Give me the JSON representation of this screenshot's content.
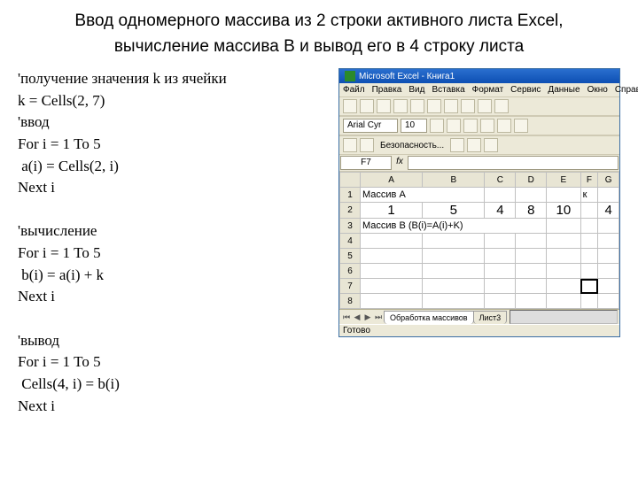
{
  "title_line1": "Ввод одномерного массива из 2 строки активного листа Excel,",
  "title_line2": "вычисление массива B и вывод его в 4 строку листа",
  "code_lines": [
    "'получение значения k из ячейки",
    "k = Cells(2, 7)",
    "'ввод",
    "For i = 1 To 5",
    " a(i) = Cells(2, i)",
    "Next i",
    "",
    "'вычисление",
    "For i = 1 To 5",
    " b(i) = a(i) + k",
    "Next i",
    "",
    "'вывод",
    "For i = 1 To 5",
    " Cells(4, i) = b(i)",
    "Next i"
  ],
  "excel": {
    "app_title": "Microsoft Excel - Книга1",
    "menu": [
      "Файл",
      "Правка",
      "Вид",
      "Вставка",
      "Формат",
      "Сервис",
      "Данные",
      "Окно",
      "Справка"
    ],
    "font_name": "Arial Cyr",
    "font_size": "10",
    "security_label": "Безопасность...",
    "namebox": "F7",
    "fx_label": "fx",
    "columns": [
      "A",
      "B",
      "C",
      "D",
      "E",
      "F",
      "G"
    ],
    "row1": {
      "A": "Массив A",
      "F": "к"
    },
    "row2": {
      "A": "1",
      "B": "5",
      "C": "4",
      "D": "8",
      "E": "10",
      "G": "4"
    },
    "row3": {
      "A": "Массив B (B(i)=A(i)+K)"
    },
    "tabs": {
      "active": "Обработка массивов",
      "other": "Лист3"
    },
    "status": "Готово"
  }
}
